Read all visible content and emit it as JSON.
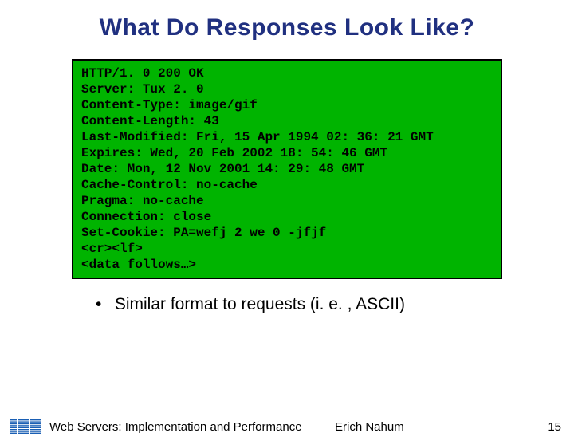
{
  "title": "What Do Responses Look Like?",
  "code_lines": [
    "HTTP/1. 0 200 OK",
    "Server: Tux 2. 0",
    "Content-Type: image/gif",
    "Content-Length: 43",
    "Last-Modified: Fri, 15 Apr 1994 02: 36: 21 GMT",
    "Expires: Wed, 20 Feb 2002 18: 54: 46 GMT",
    "Date: Mon, 12 Nov 2001 14: 29: 48 GMT",
    "Cache-Control: no-cache",
    "Pragma: no-cache",
    "Connection: close",
    "Set-Cookie: PA=wefj 2 we 0 -jfjf",
    "<cr><lf>",
    "<data follows…>"
  ],
  "bullet": {
    "mark": "•",
    "text": "Similar format to requests (i. e. , ASCII)"
  },
  "footer": {
    "title": "Web Servers: Implementation and Performance",
    "author": "Erich Nahum",
    "page": "15"
  }
}
